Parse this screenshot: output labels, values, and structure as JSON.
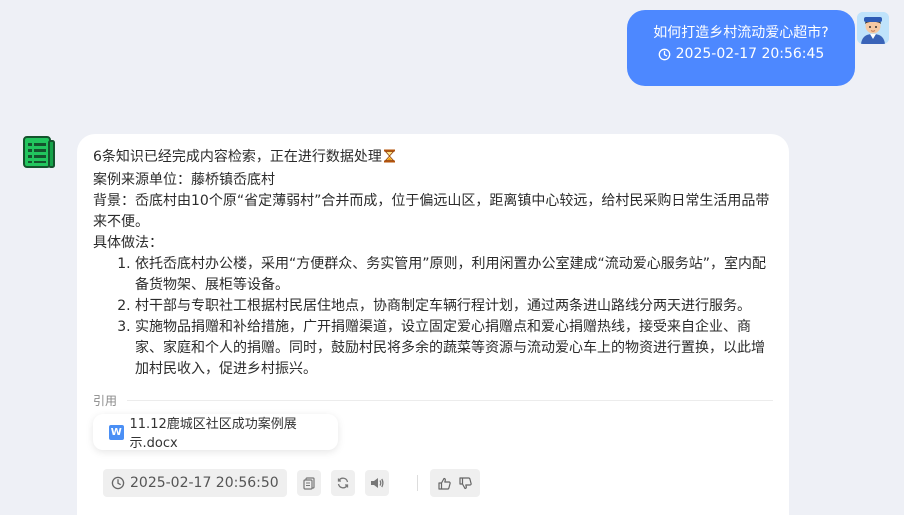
{
  "user_message": {
    "question": "如何打造乡村流动爱心超市?",
    "timestamp": "2025-02-17 20:56:45"
  },
  "bot_message": {
    "status_line": "6条知识已经完成内容检索，正在进行数据处理",
    "source_unit": "案例来源单位：藤桥镇岙底村",
    "background": "背景：岙底村由10个原“省定薄弱村”合并而成，位于偏远山区，距离镇中心较远，给村民采购日常生活用品带来不便。",
    "method_heading": "具体做法：",
    "steps": [
      "依托岙底村办公楼，采用“方便群众、务实管用”原则，利用闲置办公室建成“流动爱心服务站”，室内配备货物架、展柜等设备。",
      "村干部与专职社工根据村民居住地点，协商制定车辆行程计划，通过两条进山路线分两天进行服务。",
      "实施物品捐赠和补给措施，广开捐赠渠道，设立固定爱心捐赠点和爱心捐赠热线，接受来自企业、商家、家庭和个人的捐赠。同时，鼓励村民将多余的蔬菜等资源与流动爱心车上的物资进行置换，以此增加村民收入，促进乡村振兴。"
    ],
    "citation_label": "引用",
    "citation_file": "11.12鹿城区社区成功案例展示.docx",
    "timestamp": "2025-02-17 20:56:50"
  },
  "icons": {
    "status": "hourglass-icon",
    "copy": "copy-icon",
    "regenerate": "refresh-icon",
    "speak": "speaker-icon",
    "like": "thumbs-up-icon",
    "dislike": "thumbs-down-icon"
  },
  "colors": {
    "user_bubble": "#4d88ff",
    "bot_avatar": "#22c55e",
    "background": "#eef0f6"
  }
}
